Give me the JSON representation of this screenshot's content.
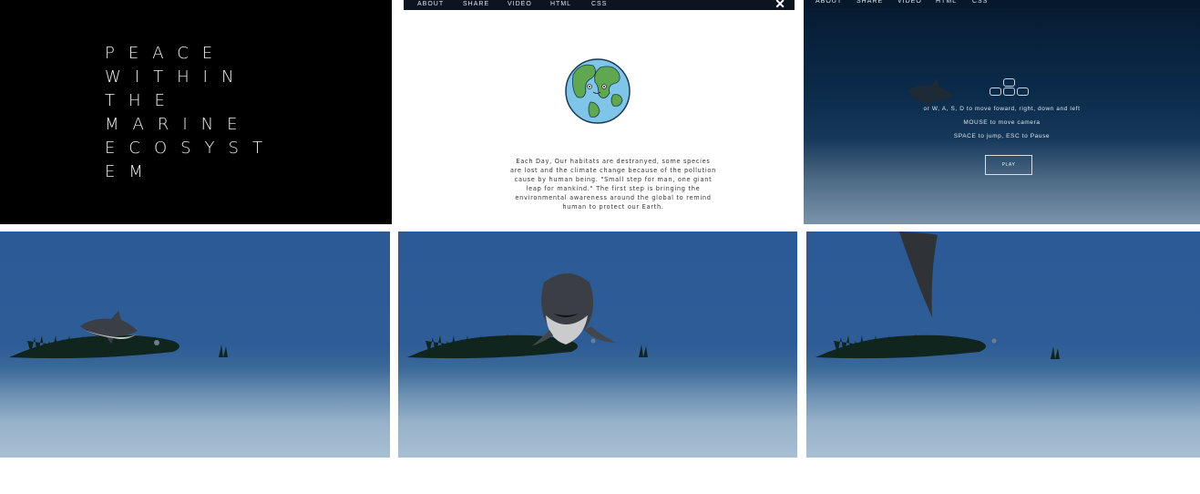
{
  "title_screen": {
    "lines": [
      "PEACE",
      "WITHIN",
      "THE",
      "MARINE",
      "ECOSYST",
      "EM"
    ]
  },
  "nav": {
    "items": [
      "ABOUT",
      "SHARE",
      "VIDEO",
      "HTML",
      "CSS"
    ],
    "close_glyph": "✕"
  },
  "about": {
    "lines": [
      "Each Day, Our habitats are destranyed, some species",
      "are lost and the climate change because of the pollution",
      "cause by human being. \"Small step for man, one giant",
      "leap for mankind.\" The first step is bringing the",
      "environmental awareness around the global to remind",
      "human to protect our Earth."
    ]
  },
  "instructions": {
    "movement": "or  W,  A,  S,  D  to move foward, right, down and left",
    "mouse": "MOUSE to move camera",
    "keys": "SPACE to jump, ESC to Pause",
    "play_label": "PLAY"
  },
  "icons": {
    "earth": "earth-icon",
    "arrow_keys": "arrow-keys-icon",
    "close": "close-icon"
  },
  "colors": {
    "title_bg": "#000000",
    "nav_bg": "#0c1420",
    "ocean": "#2e5c97",
    "sand": "#a8bfd3"
  }
}
